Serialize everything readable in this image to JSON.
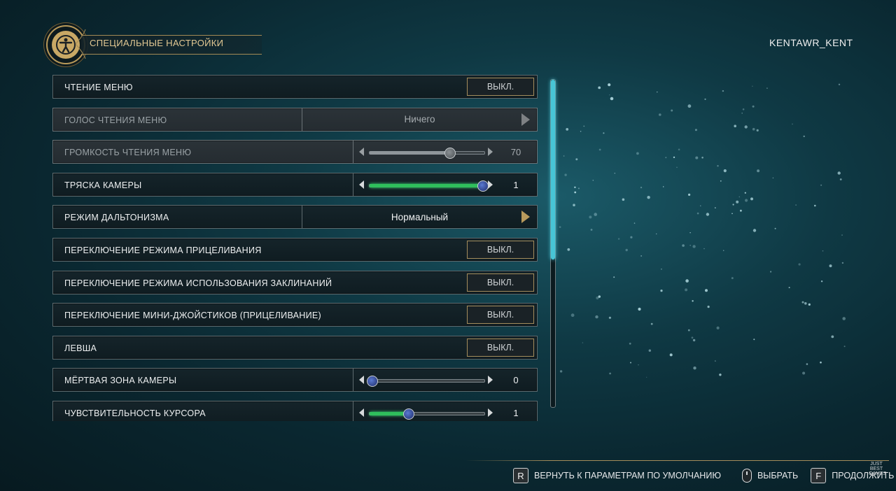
{
  "header": {
    "title": "Специальные настройки",
    "username": "KENTAWR_KENT",
    "emblem_icon": "accessibility-figure-icon"
  },
  "colors": {
    "accent_gold": "#b99a5a",
    "slider_green": "#2fbf5c",
    "scroll_cyan": "#47c5d6"
  },
  "settings": [
    {
      "label": "Чтение меню",
      "type": "toggle",
      "value": "ВЫКЛ.",
      "enabled": true
    },
    {
      "label": "Голос чтения меню",
      "type": "selector",
      "value": "Ничего",
      "enabled": false
    },
    {
      "label": "Громкость чтения меню",
      "type": "slider",
      "value": "70",
      "level": 0.7,
      "enabled": false
    },
    {
      "label": "Тряска камеры",
      "type": "slider",
      "value": "1",
      "level": 1.0,
      "enabled": true
    },
    {
      "label": "Режим дальтонизма",
      "type": "selector",
      "value": "Нормальный",
      "enabled": true
    },
    {
      "label": "Переключение режима прицеливания",
      "type": "toggle",
      "value": "ВЫКЛ.",
      "enabled": true
    },
    {
      "label": "Переключение режима использования заклинаний",
      "type": "toggle",
      "value": "ВЫКЛ.",
      "enabled": true
    },
    {
      "label": "Переключение мини-джойстиков (прицеливание)",
      "type": "toggle",
      "value": "ВЫКЛ.",
      "enabled": true
    },
    {
      "label": "Левша",
      "type": "toggle",
      "value": "ВЫКЛ.",
      "enabled": true
    },
    {
      "label": "Мёртвая зона камеры",
      "type": "slider",
      "value": "0",
      "level": 0.0,
      "enabled": true
    },
    {
      "label": "Чувствительность курсора",
      "type": "slider",
      "value": "1",
      "level": 0.33,
      "enabled": true
    }
  ],
  "scrollbar": {
    "position": 0.0,
    "visible_fraction": 0.55
  },
  "footer": {
    "reset_key": "R",
    "reset_label": "Вернуть к параметрам по умолчанию",
    "select_icon": "mouse-icon",
    "select_label": "Выбрать",
    "continue_key": "F",
    "continue_label": "Продолжить",
    "logo_text": "JUST BEST GAMES"
  }
}
